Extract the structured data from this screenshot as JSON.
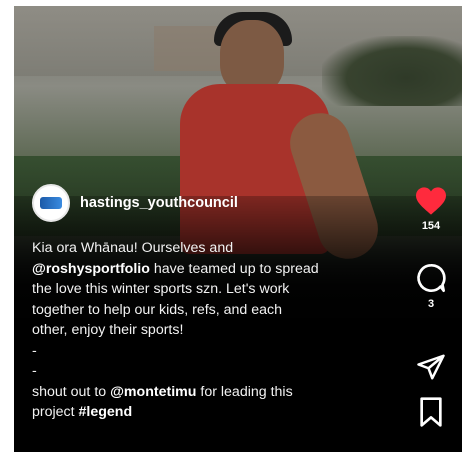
{
  "post": {
    "username": "hastings_youthcouncil",
    "caption": {
      "line1": "Kia ora Whānau! Ourselves and",
      "line2_mention": "@roshysportfolio",
      "line2_rest": " have teamed up to spread",
      "line3": "the love this winter sports szn. Let's work",
      "line4": "together to help our kids, refs, and each",
      "line5": "other, enjoy their sports!",
      "dash1": "-",
      "dash2": "-",
      "shout_prefix": "shout out to ",
      "shout_mention": "@montetimu",
      "shout_rest": " for leading this",
      "project_prefix": "project ",
      "hashtag": "#legend"
    }
  },
  "actions": {
    "likes": "154",
    "comments": "3",
    "like_icon": "heart-icon",
    "comment_icon": "comment-icon",
    "share_icon": "send-icon",
    "save_icon": "bookmark-icon",
    "like_color": "#ff2a3d"
  }
}
